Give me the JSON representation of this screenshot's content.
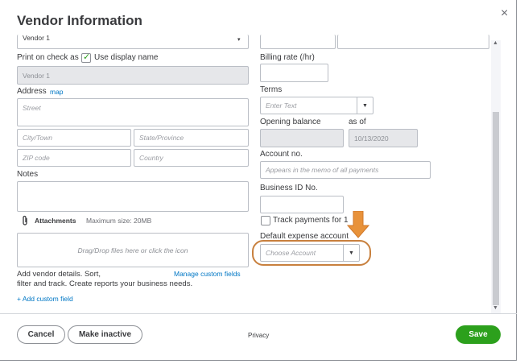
{
  "dialog": {
    "title": "Vendor Information",
    "close_glyph": "×"
  },
  "left": {
    "top_select_value": "Vendor 1",
    "print_on_check_label": "Print on check as",
    "use_display_name_label": "Use display name",
    "use_display_name_checked": true,
    "print_name_value": "Vendor 1",
    "address_label": "Address",
    "map_link": "map",
    "street_placeholder": "Street",
    "city_placeholder": "City/Town",
    "state_placeholder": "State/Province",
    "zip_placeholder": "ZIP code",
    "country_placeholder": "Country",
    "notes_label": "Notes",
    "attachments_label": "Attachments",
    "max_size_label": "Maximum size: 20MB",
    "dropzone_text": "Drag/Drop files here or click the icon",
    "custom_fields_text_1": "Add vendor details. Sort,",
    "custom_fields_text_2": "filter and track. Create reports your business needs.",
    "manage_custom_fields_link": "Manage custom fields",
    "add_custom_field_link": "+ Add custom field"
  },
  "right": {
    "billing_rate_label": "Billing rate (/hr)",
    "terms_label": "Terms",
    "terms_placeholder": "Enter Text",
    "opening_balance_label": "Opening balance",
    "as_of_label": "as of",
    "as_of_value": "10/13/2020",
    "account_no_label": "Account no.",
    "account_no_placeholder": "Appears in the memo of all payments",
    "business_id_label": "Business ID No.",
    "track_payments_label": "Track payments for 1",
    "default_expense_label": "Default expense account",
    "choose_account_placeholder": "Choose Account"
  },
  "footer": {
    "cancel_label": "Cancel",
    "make_inactive_label": "Make inactive",
    "privacy_label": "Privacy",
    "save_label": "Save"
  },
  "colors": {
    "accent_green": "#2ca01c",
    "link_blue": "#0077c5",
    "annotation_orange": "#e8923a"
  }
}
